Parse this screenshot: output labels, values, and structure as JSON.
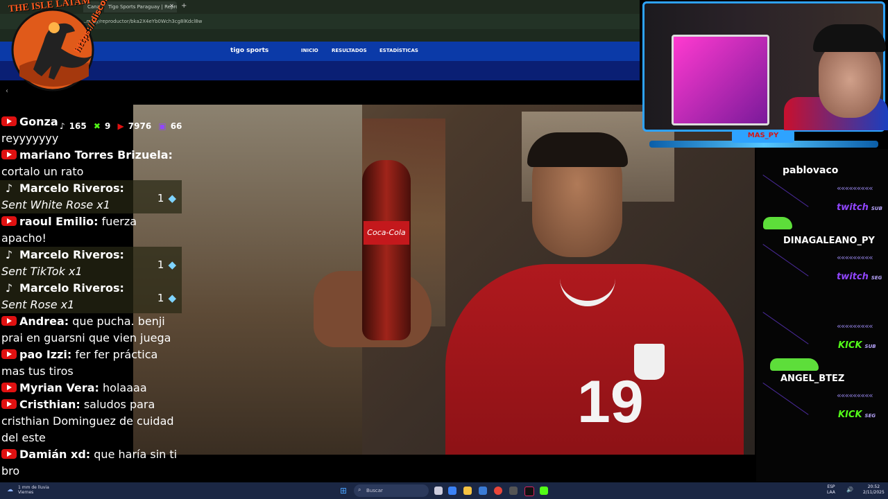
{
  "browser": {
    "tabs": [
      {
        "label": "Canal del Sensei (Va..."
      },
      {
        "label": "Tigo Sports Paraguay | Reprodu..."
      }
    ],
    "new_tab_symbol": "+",
    "url": "...m.py/reproductor/bka2X4eYb0Wch3cg8lKdcl8w"
  },
  "site": {
    "logo": "tigo sports",
    "nav": [
      "INICIO",
      "RESULTADOS",
      "ESTADÍSTICAS"
    ]
  },
  "overlay_logo": {
    "title": "THE ISLE LATAM",
    "url": "https://discord.gg/theislelatam"
  },
  "counts": {
    "tiktok": "165",
    "kick": "9",
    "youtube": "7976",
    "twitch": "66"
  },
  "chat": [
    {
      "platform": "youtube",
      "name": "Gonza",
      "text": "reyyyyyyy"
    },
    {
      "platform": "youtube",
      "name": "mariano Torres Brizuela:",
      "text": "cortalo un rato"
    },
    {
      "platform": "tiktok",
      "name": "Marcelo Riveros:",
      "text": "Sent White Rose x1",
      "gift": "1"
    },
    {
      "platform": "youtube",
      "name": "raoul Emilio:",
      "text": "fuerza apacho!"
    },
    {
      "platform": "tiktok",
      "name": "Marcelo Riveros:",
      "text": "Sent TikTok x1",
      "gift": "1"
    },
    {
      "platform": "tiktok",
      "name": "Marcelo Riveros:",
      "text": "Sent Rose x1",
      "gift": "1"
    },
    {
      "platform": "youtube",
      "name": "Andrea:",
      "text": "que pucha. benji prai en guarsni que vien juega"
    },
    {
      "platform": "youtube",
      "name": "pao Izzi:",
      "text": "fer fer práctica mas tus tiros"
    },
    {
      "platform": "youtube",
      "name": "Myrian Vera:",
      "text": "holaaaa"
    },
    {
      "platform": "youtube",
      "name": "Cristhian:",
      "text": "saludos para cristhian Dominguez de cuidad del este"
    },
    {
      "platform": "youtube",
      "name": "Damián xd:",
      "text": "que haría sin ti bro"
    }
  ],
  "video": {
    "bottle_label": "Coca-Cola",
    "jersey_number": "19"
  },
  "webcam": {
    "name": "MAS_PY"
  },
  "alerts": [
    {
      "name": "pablovaco",
      "platform": "twitch",
      "tag": "SUB"
    },
    {
      "name": "DINAGALEANO_PY",
      "platform": "twitch",
      "tag": "SEG"
    },
    {
      "name": "",
      "platform": "KICK",
      "tag": "SUB"
    },
    {
      "name": "ANGEL_BTEZ",
      "platform": "KICK",
      "tag": "SEG"
    }
  ],
  "colors": {
    "twitch": "#9146ff",
    "kick": "#53fc18",
    "youtube": "#e01111",
    "webcam_border": "#2ea3ff"
  },
  "taskbar": {
    "weather": "1 mm de lluvia",
    "weather_day": "Viernes",
    "search": "Buscar",
    "lang": "ESP",
    "lang2": "LAA",
    "time": "20:52",
    "date": "2/11/2025"
  }
}
